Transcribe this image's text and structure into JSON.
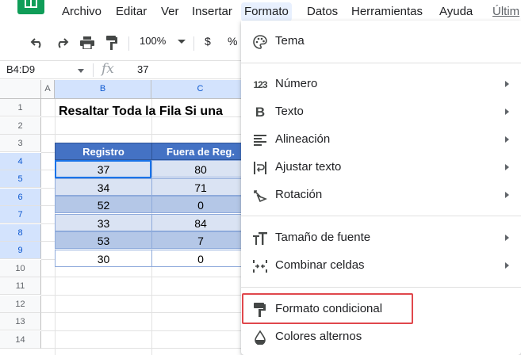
{
  "menubar": {
    "items": [
      {
        "label": "Archivo"
      },
      {
        "label": "Editar"
      },
      {
        "label": "Ver"
      },
      {
        "label": "Insertar"
      },
      {
        "label": "Formato"
      },
      {
        "label": "Datos"
      },
      {
        "label": "Herramientas"
      },
      {
        "label": "Ayuda"
      },
      {
        "label": "Últim"
      }
    ],
    "active": "Formato"
  },
  "toolbar": {
    "zoom": "100%",
    "currency": "$",
    "percent": "%"
  },
  "formula_bar": {
    "name_box": "B4:D9",
    "fx_icon": "fx-icon",
    "value": "37"
  },
  "grid": {
    "columns": [
      "A",
      "B",
      "C"
    ],
    "rows": [
      "1",
      "2",
      "3",
      "4",
      "5",
      "6",
      "7",
      "8",
      "9",
      "10",
      "11",
      "12",
      "13",
      "14"
    ],
    "title": "Resaltar Toda la Fila Si una",
    "table": {
      "headers": [
        "Registro",
        "Fuera de Reg."
      ],
      "rows": [
        [
          "37",
          "80"
        ],
        [
          "34",
          "71"
        ],
        [
          "52",
          "0"
        ],
        [
          "33",
          "84"
        ],
        [
          "53",
          "7"
        ],
        [
          "30",
          "0"
        ]
      ]
    }
  },
  "format_menu": {
    "items": [
      {
        "icon": "palette-icon",
        "label": "Tema"
      },
      {
        "icon": "number-format-icon",
        "label": "Número"
      },
      {
        "icon": "bold-icon",
        "label": "Texto"
      },
      {
        "icon": "align-left-icon",
        "label": "Alineación"
      },
      {
        "icon": "text-wrap-icon",
        "label": "Ajustar texto"
      },
      {
        "icon": "text-rotation-icon",
        "label": "Rotación"
      },
      {
        "icon": "font-size-icon",
        "label": "Tamaño de fuente"
      },
      {
        "icon": "merge-cells-icon",
        "label": "Combinar celdas"
      },
      {
        "icon": "paint-roller-icon",
        "label": "Formato condicional"
      },
      {
        "icon": "color-drop-icon",
        "label": "Colores alternos"
      }
    ]
  },
  "colors": {
    "header_blue": "#4472c4",
    "row_light": "#dae3f3",
    "row_dark": "#b4c7e7",
    "highlight_red": "#e0474c",
    "selection_blue": "#1a73e8"
  }
}
